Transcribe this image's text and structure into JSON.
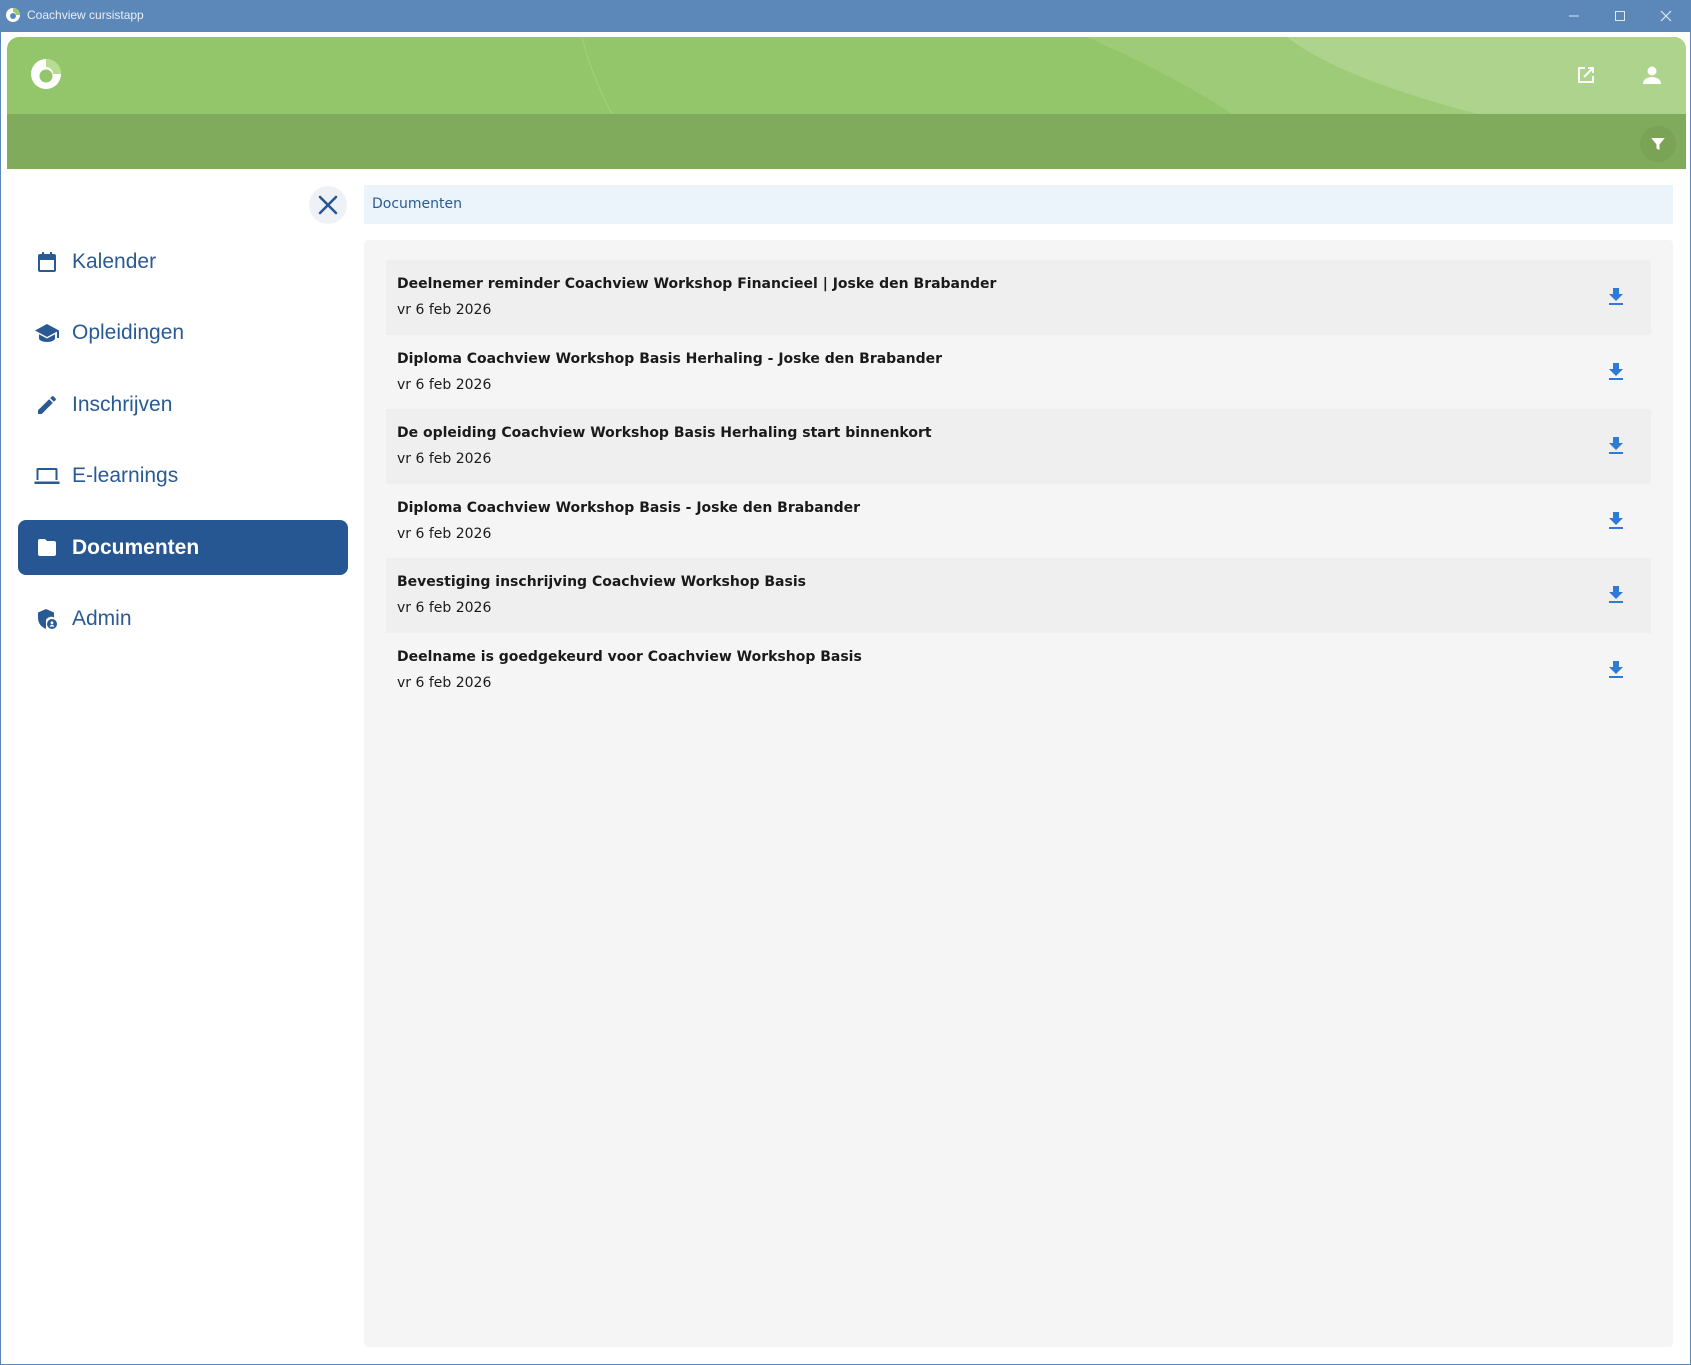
{
  "window": {
    "title": "Coachview cursistapp",
    "titlebar_color": "#5b88b9"
  },
  "header": {
    "top_color": "#93c66a",
    "bottom_color": "#80ab5c",
    "icons": [
      "coachview-logo-icon",
      "open-external-icon",
      "user-icon",
      "filter-icon"
    ]
  },
  "sidebar": {
    "close_icon": "close-icon",
    "items": [
      {
        "label": "Kalender",
        "icon": "calendar-icon",
        "active": false
      },
      {
        "label": "Opleidingen",
        "icon": "graduation-cap-icon",
        "active": false
      },
      {
        "label": "Inschrijven",
        "icon": "pencil-icon",
        "active": false
      },
      {
        "label": "E-learnings",
        "icon": "laptop-icon",
        "active": false
      },
      {
        "label": "Documenten",
        "icon": "folder-icon",
        "active": true
      },
      {
        "label": "Admin",
        "icon": "admin-shield-icon",
        "active": false
      }
    ],
    "active_color": "#275793",
    "text_color": "#2a5a94"
  },
  "main": {
    "breadcrumb": "Documenten",
    "documents": [
      {
        "title": "Deelnemer reminder Coachview Workshop Financieel | Joske den Brabander",
        "date": "vr 6 feb 2026"
      },
      {
        "title": "Diploma Coachview Workshop Basis Herhaling - Joske den Brabander",
        "date": "vr 6 feb 2026"
      },
      {
        "title": "De opleiding Coachview Workshop Basis Herhaling start binnenkort",
        "date": "vr 6 feb 2026"
      },
      {
        "title": "Diploma Coachview Workshop Basis - Joske den Brabander",
        "date": "vr 6 feb 2026"
      },
      {
        "title": "Bevestiging inschrijving Coachview Workshop Basis",
        "date": "vr 6 feb 2026"
      },
      {
        "title": "Deelname is goedgekeurd voor Coachview Workshop Basis",
        "date": "vr 6 feb 2026"
      }
    ],
    "download_icon": "download-icon",
    "download_color": "#2f7ad6"
  }
}
